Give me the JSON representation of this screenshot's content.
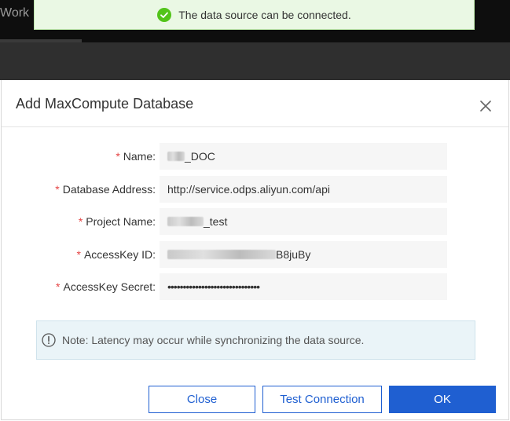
{
  "background": {
    "title": "Work"
  },
  "toast": {
    "message": "The data source can be connected.",
    "icon": "check-circle-icon",
    "color": "#52c41a"
  },
  "dialog": {
    "title": "Add MaxCompute Database",
    "close_icon": "close-icon",
    "fields": [
      {
        "label": "Name:",
        "required": "*",
        "value_suffix": "_DOC"
      },
      {
        "label": "Database Address:",
        "required": "*",
        "value": "http://service.odps.aliyun.com/api"
      },
      {
        "label": "Project Name:",
        "required": "*",
        "value_suffix": "_test"
      },
      {
        "label": "AccessKey ID:",
        "required": "*",
        "value_suffix": "B8juBy"
      },
      {
        "label": "AccessKey Secret:",
        "required": "*",
        "value": "••••••••••••••••••••••••••••••"
      }
    ],
    "notice": "Note: Latency may occur while synchronizing the data source.",
    "buttons": {
      "close": "Close",
      "test": "Test Connection",
      "ok": "OK"
    },
    "accent_color": "#1f5fd1"
  }
}
